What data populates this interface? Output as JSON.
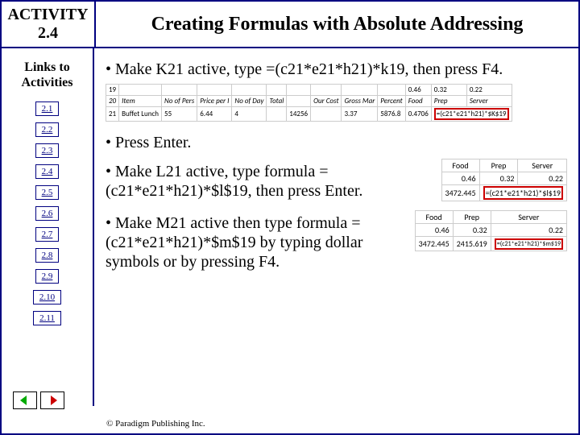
{
  "header": {
    "activity": "ACTIVITY 2.4",
    "title": "Creating Formulas with Absolute Addressing"
  },
  "sidebar": {
    "title": "Links to Activities",
    "items": [
      "2.1",
      "2.2",
      "2.3",
      "2.4",
      "2.5",
      "2.6",
      "2.7",
      "2.8",
      "2.9",
      "2.10",
      "2.11"
    ]
  },
  "content": {
    "b1_pre": "• Make K21 active, type ",
    "b1_formula": "=(c21*e21*h21)*k19",
    "b1_post": ", then press F4.",
    "b2": "• Press Enter.",
    "b3_pre": "• Make L21 active, type formula ",
    "b3_formula": "=(c21*e21*h21)*$l$19",
    "b3_post": ", then press Enter.",
    "b4_pre": "• Make M21 active then type formula ",
    "b4_formula": "=(c21*e21*h21)*$m$19",
    "b4_post": " by typing dollar symbols or by pressing F4."
  },
  "big_table": {
    "rows": [
      "19",
      "20",
      "21"
    ],
    "headers_row20": [
      "Item",
      "No of Pers",
      "Price per I",
      "No of Day",
      "Total",
      "",
      "Our Cost",
      "Gross Mar",
      "Percent",
      "Food",
      "Prep",
      "Server"
    ],
    "values_row19": [
      "",
      "",
      "",
      "",
      "",
      "",
      "",
      "",
      "",
      "0.46",
      "0.32",
      "0.22"
    ],
    "row21": [
      "Buffet Lunch",
      "55",
      "6.44",
      "4",
      "",
      "14256",
      "",
      "3.37",
      "5876.8",
      "0.4706",
      "=(c21*e21*h21)*$K$19"
    ]
  },
  "mini_table_L": {
    "headers": [
      "Food",
      "Prep",
      "Server"
    ],
    "line1": [
      "0.46",
      "0.32",
      "0.22"
    ],
    "line2_left": "3472.445",
    "line2_right": "=(c21*e21*h21)*$l$19"
  },
  "mini_table_M": {
    "headers": [
      "Food",
      "Prep",
      "Server"
    ],
    "line1": [
      "0.46",
      "0.32",
      "0.22"
    ],
    "line2_l": "3472.445",
    "line2_m": "2415.619",
    "line2_r": "=(c21*e21*h21)*$m$19"
  },
  "footer": "© Paradigm Publishing Inc."
}
